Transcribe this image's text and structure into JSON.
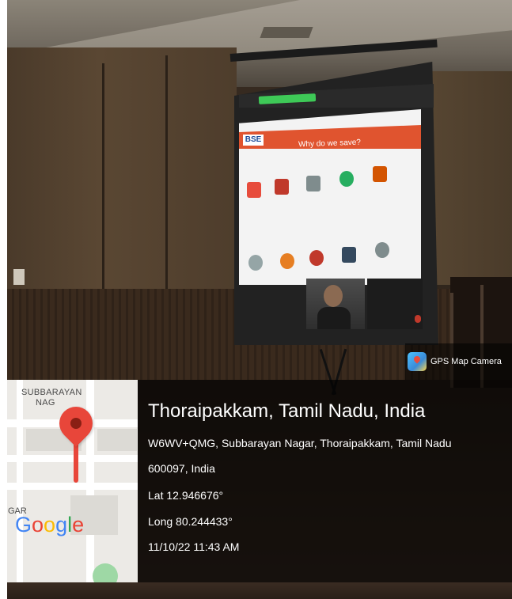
{
  "slide": {
    "logo_text": "BSE",
    "title": "Why do we save?",
    "icons": [
      "#e74c3c",
      "#c0392b",
      "#7f8c8d",
      "#27ae60",
      "#d35400",
      "#95a5a6",
      "#e67e22",
      "#c0392b",
      "#34495e",
      "#7f8c8d"
    ]
  },
  "gps_badge": {
    "label": "GPS Map Camera",
    "icon": "gps-map-camera-app-icon"
  },
  "map": {
    "label_line1": "SUBBARAYAN",
    "label_line2": "NAG",
    "label_line3": "GAR",
    "logo_letters": [
      "G",
      "o",
      "o",
      "g",
      "l",
      "e"
    ],
    "pin_icon": "map-pin-icon",
    "pin_color": "#e8463a"
  },
  "location": {
    "title": "Thoraipakkam, Tamil Nadu, India",
    "address_line1": "W6WV+QMG, Subbarayan Nagar, Thoraipakkam, Tamil Nadu",
    "address_line2": "600097, India",
    "lat": "Lat 12.946676°",
    "long": "Long 80.244433°",
    "datetime": "11/10/22 11:43 AM"
  }
}
